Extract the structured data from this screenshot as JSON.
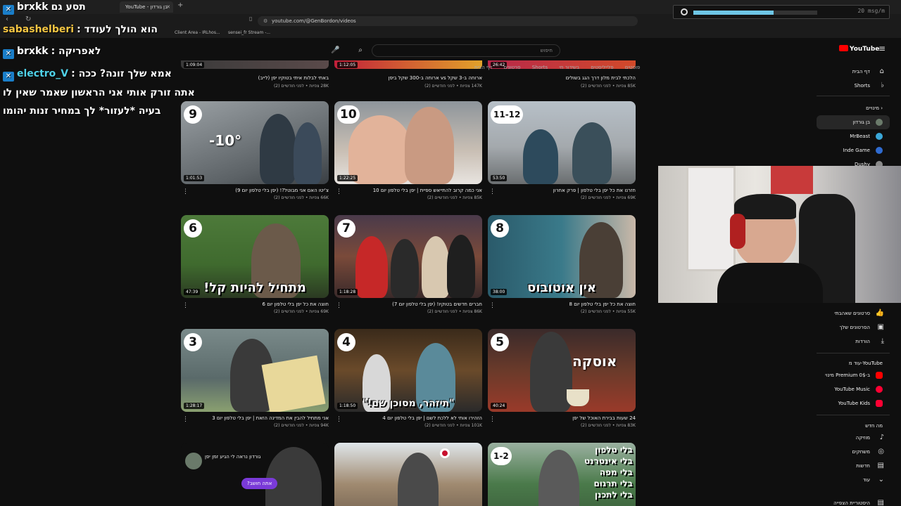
{
  "browser": {
    "tab_title": "YouTube - בן גורדון",
    "new_tab": "+",
    "url": "youtube.com/@GenBordon/videos",
    "bookmarks": [
      "Client Area - IRLhos...",
      "sensei_fr Stream -..."
    ]
  },
  "chat": [
    {
      "user": "brxkk",
      "message": "תסע גם",
      "user_color": "#ffffff"
    },
    {
      "user": "sabashelberi",
      "message": "הוא הולך לעודד :",
      "user_color": "#f5c542"
    },
    {
      "user": "brxkk",
      "message": "לאפריקה :",
      "user_color": "#ffffff"
    },
    {
      "user": "electro_V",
      "message": "אמא שלך זונה? ככה :",
      "user_color": "#4fd1e8"
    },
    {
      "user": "",
      "message": "אתה זורק אותי אני הראשון שאמר שאין לו",
      "user_color": "#ffffff"
    },
    {
      "user": "",
      "message": "בעיה *לעזור* לך במחיר זנות יהומו",
      "user_color": "#ffffff"
    }
  ],
  "streambar": {
    "value": "20 msg/m",
    "level": 0.65
  },
  "masthead": {
    "search_placeholder": "חיפוש",
    "logo": "YouTube"
  },
  "filters": [
    "דף הבית",
    "סרטונים",
    "Shorts",
    "בשידור חי",
    "פלייליסטים",
    "פוסטים"
  ],
  "top_row": [
    {
      "title": "הלכתי לבית מלון דרך הגג בשולים",
      "meta": "85K צפיות • לפני חודשיים (2)",
      "duration": "26:42"
    },
    {
      "title": "ארוחה ב-3 שקל vs ארוחה ב-300 שקל ביפן",
      "meta": "147K צפיות • לפני חודשיים (2)",
      "duration": "1:12:05"
    },
    {
      "title": "באתי לבלות איתי בטוקיו יפן (לייב)",
      "meta": "28K צפיות • לפני חודשיים (2)",
      "duration": "1:09:04"
    }
  ],
  "videos": [
    {
      "badge": "9",
      "duration": "1:01:53",
      "title": "צ'יטו האם אני מבוטל?! (יפן בלי טלפון יום 9)",
      "meta": "66K צפיות • לפני חודשיים (2)",
      "overlay": "-10°"
    },
    {
      "badge": "10",
      "duration": "1:22:25",
      "title": "אני כמה קרוב להתייאש ספיית | יפן בלי טלפון יום 10",
      "meta": "85K צפיות • לפני חודשיים (2)",
      "overlay": ""
    },
    {
      "badge": "11-12",
      "duration": "53:50",
      "title": "חזרנו את כל יפן בלי טלפון | פרק אחרון",
      "meta": "69K צפיות • לפני חודשיים (2)",
      "overlay": ""
    },
    {
      "badge": "6",
      "duration": "47:39",
      "title": "חוצה את כל יפן בלי טלפון יום 6",
      "meta": "69K צפיות • לפני חודשיים (2)",
      "overlay": "מתחיל להיות קל!"
    },
    {
      "badge": "7",
      "duration": "1:18:28",
      "title": "חברים חדשים בטוקיו! (יפן בלי טלפון יום 7)",
      "meta": "86K צפיות • לפני חודשיים (2)",
      "overlay": ""
    },
    {
      "badge": "8",
      "duration": "38:00",
      "title": "חוצה את כל יפן בלי טלפון יום 8",
      "meta": "55K צפיות • לפני חודשיים (2)",
      "overlay": "אין אוטובוס"
    },
    {
      "badge": "3",
      "duration": "1:28:17",
      "title": "אני מתחיל להבין את המדינה הזאת | יפן בלי טלפון יום 3",
      "meta": "94K צפיות • לפני חודשיים (2)",
      "overlay": ""
    },
    {
      "badge": "4",
      "duration": "1:18:50",
      "title": "הזהירו אותי לא ללכת לשם | יפן בלי טלפון יום 4",
      "meta": "101K צפיות • לפני חודשיים (2)",
      "overlay": "\"תיזהר, מסוכן שם!\""
    },
    {
      "badge": "5",
      "duration": "40:24",
      "title": "24 שעות בבירת האוכל של יפן",
      "meta": "83K צפיות • לפני חודשיים (2)",
      "overlay": "אוסקה"
    },
    {
      "badge": "",
      "duration": "",
      "title": "",
      "meta": "",
      "overlay": "אתה חושב?"
    },
    {
      "badge": "",
      "duration": "",
      "title": "",
      "meta": "",
      "overlay": ""
    },
    {
      "badge": "1-2",
      "duration": "",
      "title": "",
      "meta": "",
      "overlay": "בלי טלפון\nבלי אינטרנט\nבלי מפה\nבלי תרגום\nבלי לתכנן"
    }
  ],
  "bubble": {
    "text": "גורדון נראה לי הגיע זמן יפן"
  },
  "sidebar": {
    "top": [
      {
        "label": "דף הבית",
        "icon": "home-icon"
      },
      {
        "label": "Shorts",
        "icon": "shorts-icon"
      }
    ],
    "subs_header": "מינויים",
    "subs": [
      {
        "label": "בן גורדון",
        "color": "#6b7b6b"
      },
      {
        "label": "MrBeast",
        "color": "#3aa7d8"
      },
      {
        "label": "Inde Game",
        "color": "#2f6bd0"
      },
      {
        "label": "Dushy",
        "color": "#8a8a8a"
      }
    ],
    "you": [
      {
        "label": "סרטונים שאהבתי",
        "icon": "like-icon"
      },
      {
        "label": "הסרטונים שלך",
        "icon": "video-icon"
      },
      {
        "label": "הורדות",
        "icon": "download-icon"
      }
    ],
    "more_header": "עוד מ-YouTube",
    "more": [
      {
        "label": "מינוי Premium ב-0$",
        "color": "#ff0000"
      },
      {
        "label": "YouTube Music",
        "color": "#ff0033"
      },
      {
        "label": "YouTube Kids",
        "color": "#ff0033"
      }
    ],
    "new_header": "מה חדש",
    "explore": [
      {
        "label": "מוזיקה",
        "icon": "music-icon"
      },
      {
        "label": "משחקים",
        "icon": "gaming-icon"
      },
      {
        "label": "חדשות",
        "icon": "news-icon"
      },
      {
        "label": "עוד",
        "icon": "chevron-down-icon"
      }
    ],
    "history": "היסטוריית הצפייה"
  }
}
